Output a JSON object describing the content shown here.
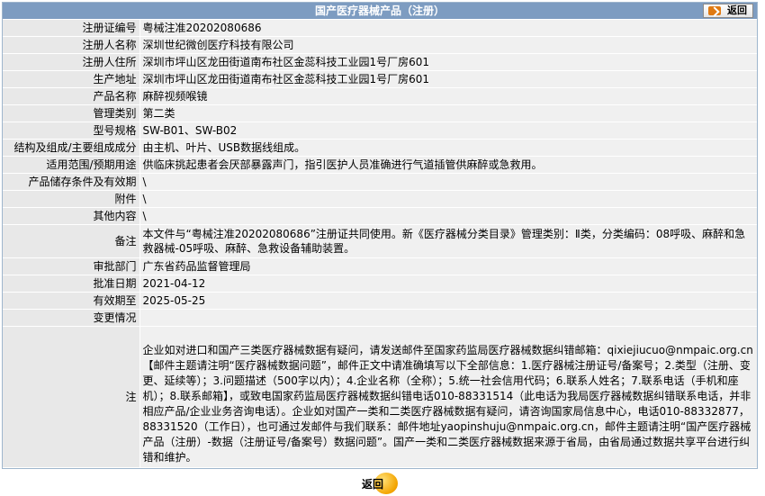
{
  "header": {
    "title": "国产医疗器械产品（注册）",
    "back_label": "返回"
  },
  "fields": [
    {
      "label": "注册证编号",
      "value": "粤械注准20202080686"
    },
    {
      "label": "注册人名称",
      "value": "深圳世纪微创医疗科技有限公司"
    },
    {
      "label": "注册人住所",
      "value": "深圳市坪山区龙田街道南布社区金蕊科技工业园1号厂房601"
    },
    {
      "label": "生产地址",
      "value": "深圳市坪山区龙田街道南布社区金蕊科技工业园1号厂房601"
    },
    {
      "label": "产品名称",
      "value": "麻醉视频喉镜"
    },
    {
      "label": "管理类别",
      "value": "第二类"
    },
    {
      "label": "型号规格",
      "value": "SW-B01、SW-B02"
    },
    {
      "label": "结构及组成/主要组成成分",
      "value": "由主机、叶片、USB数据线组成。"
    },
    {
      "label": "适用范围/预期用途",
      "value": "供临床挑起患者会厌部暴露声门，指引医护人员准确进行气道插管供麻醉或急救用。"
    },
    {
      "label": "产品储存条件及有效期",
      "value": "\\"
    },
    {
      "label": "附件",
      "value": "\\"
    },
    {
      "label": "其他内容",
      "value": "\\"
    },
    {
      "label": "备注",
      "value": "本文件与“粤械注准20202080686”注册证共同使用。新《医疗器械分类目录》管理类别：Ⅱ类，分类编码：08呼吸、麻醉和急救器械-05呼吸、麻醉、急救设备辅助装置。"
    },
    {
      "label": "审批部门",
      "value": "广东省药品监督管理局"
    },
    {
      "label": "批准日期",
      "value": "2021-04-12"
    },
    {
      "label": "有效期至",
      "value": "2025-05-25"
    },
    {
      "label": "变更情况",
      "value": ""
    }
  ],
  "note": {
    "label": "注",
    "value": "企业如对进口和国产三类医疗器械数据有疑问，请发送邮件至国家药监局医疗器械数据纠错邮箱：qixiejiucuo@nmpaic.org.cn【邮件主题请注明“医疗器械数据问题”，邮件正文中请准确填写以下全部信息：1.医疗器械注册证号/备案号；2.类型（注册、变更、延续等）；3.问题描述（500字以内）；4.企业名称（全称）；5.统一社会信用代码；6.联系人姓名；7.联系电话（手机和座机）；8.联系邮箱】，或致电国家药监局医疗器械数据纠错电话010-88331514（此电话为我局医疗器械数据纠错联系电话，并非相应产品/企业业务咨询电话）。企业如对国产一类和二类医疗器械数据有疑问，请咨询国家局信息中心，电话010-88332877，88331520（工作日），也可通过发邮件与我们联系：邮件地址yaopinshuju@nmpaic.org.cn，邮件主题请注明“国产医疗器械产品（注册）-数据（注册证号/备案号）数据问题”。国产一类和二类医疗器械数据来源于省局，由省局通过数据共享平台进行纠错和维护。"
  },
  "footer": {
    "back_label": "返回"
  }
}
